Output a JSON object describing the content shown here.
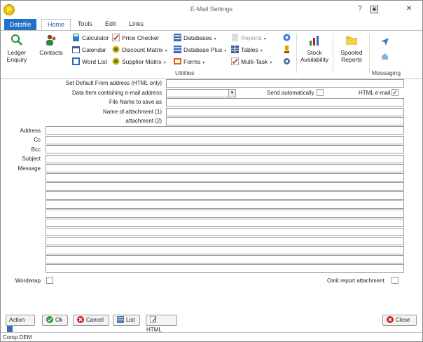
{
  "window": {
    "title": "E-Mail Settings",
    "app_icon_letter": "P",
    "help": "?",
    "restore": "⧉",
    "close": "✕"
  },
  "tabs": [
    {
      "label": "Datafile"
    },
    {
      "label": "Home"
    },
    {
      "label": "Tools"
    },
    {
      "label": "Edit"
    },
    {
      "label": "Links"
    }
  ],
  "ribbon": {
    "ledger": "Ledger Enquiry",
    "contacts": "Contacts",
    "calculator": "Calculator",
    "calendar": "Calendar",
    "word_list": "Word List",
    "price_checker": "Price Checker",
    "discount_matrix": "Discount Matrix",
    "supplier_matrix": "Supplier Matrix",
    "databases": "Databases",
    "database_plus": "Database Plus",
    "forms": "Forms",
    "reports": "Reports",
    "tables": "Tables",
    "multi_task": "Multi-Task",
    "stock_availability": "Stock Availability",
    "spooled_reports": "Spooled Reports",
    "utilities_label": "Utilities",
    "messaging_label": "Messaging"
  },
  "form": {
    "default_from_label": "Set Default From address (HTML only)",
    "data_item_label": "Data Item containing e-mail address",
    "send_auto_label": "Send automatically",
    "send_auto_checked": false,
    "html_email_label": "HTML e-mail",
    "html_email_checked": true,
    "file_name_label": "File Name to save as",
    "attachment1_label": "Name of attachment (1)",
    "attachment2_label": "attachment (2)",
    "address_label": "Address",
    "cc_label": "Cc",
    "bcc_label": "Bcc",
    "subject_label": "Subject",
    "message_label": "Message",
    "wordwrap_label": "Wordwrap",
    "wordwrap_checked": false,
    "omit_report_label": "Omit report attachment",
    "omit_report_checked": false
  },
  "buttons": {
    "action": "Action",
    "ok": "Ok",
    "cancel": "Cancel",
    "list": "List",
    "html": "HTML",
    "close": "Close"
  },
  "status": {
    "text": "Comp DEM"
  },
  "colors": {
    "accent": "#1e72c8"
  }
}
